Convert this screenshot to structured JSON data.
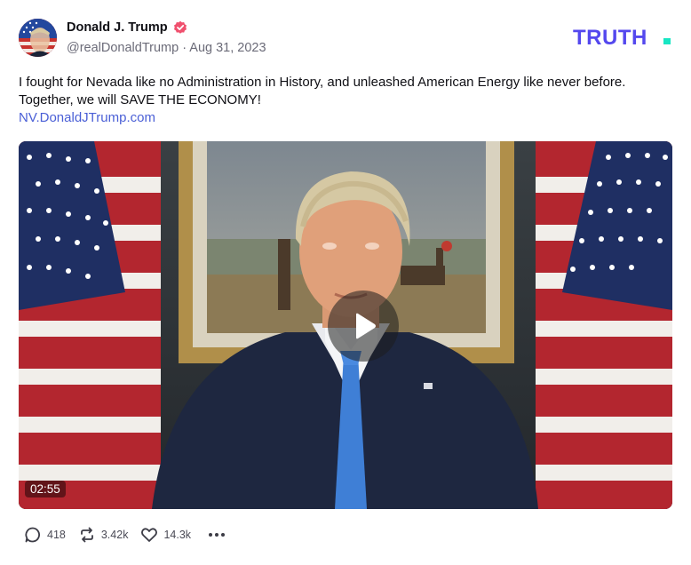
{
  "post": {
    "author": {
      "display_name": "Donald J. Trump",
      "handle_and_date": "@realDonaldTrump · Aug 31, 2023",
      "verified": true
    },
    "brand": "TRUTH.",
    "text_line1": "I fought for Nevada like no Administration in History, and unleashed American Energy like never before.",
    "text_line2": "Together, we will SAVE THE ECONOMY!",
    "link": "NV.DonaldJTrump.com",
    "video": {
      "duration": "02:55",
      "play_icon": "play-icon"
    },
    "actions": {
      "replies": "418",
      "retruths": "3.42k",
      "likes": "14.3k"
    }
  },
  "colors": {
    "brand_purple": "#5448ee",
    "brand_teal": "#17e6c3",
    "verified_badge": "#f0506e",
    "link": "#4a5fd6"
  },
  "icons": [
    "avatar",
    "verified-icon",
    "truth-logo",
    "play-icon",
    "reply-icon",
    "retruth-icon",
    "like-icon",
    "more-icon"
  ]
}
